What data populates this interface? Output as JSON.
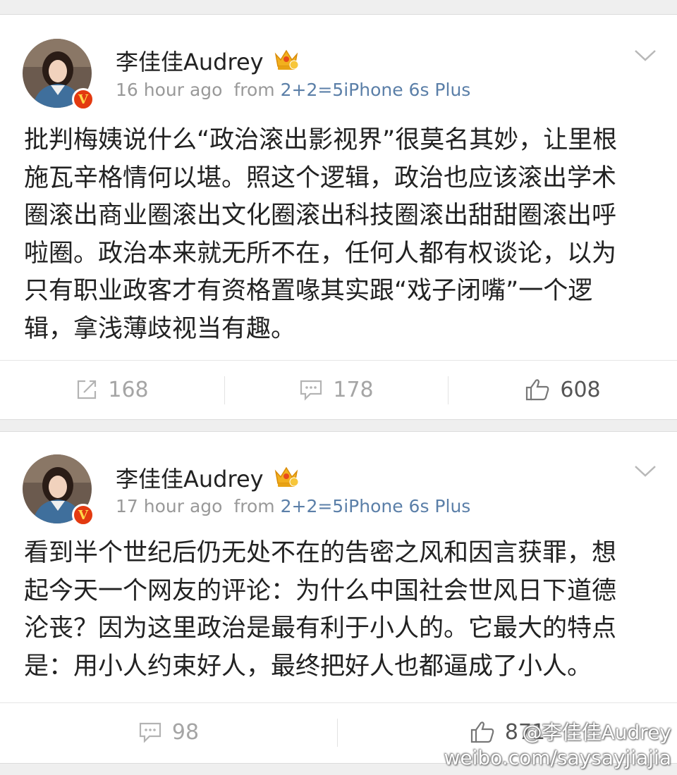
{
  "posts": [
    {
      "author": "李佳佳Audrey",
      "time": "16 hour ago",
      "from_label": "from",
      "source": "2+2=5iPhone 6s Plus",
      "verified_badge": "V",
      "body_lines": [
        "批判梅姨说什么“政治滚出影视界”很莫名其妙，让里根",
        "施瓦辛格情何以堪。照这个逻辑，政治也应该滚出学术",
        "圈滚出商业圈滚出文化圈滚出科技圈滚出甜甜圈滚出呼",
        "啦圈。政治本来就无所不在，任何人都有权谈论，以为",
        "只有职业政客才有资格置喙其实跟“戏子闭嘴”一个逻",
        "辑，拿浅薄歧视当有趣。"
      ],
      "reposts": "168",
      "comments": "178",
      "likes": "608"
    },
    {
      "author": "李佳佳Audrey",
      "time": "17 hour ago",
      "from_label": "from",
      "source": "2+2=5iPhone 6s Plus",
      "verified_badge": "V",
      "body_lines": [
        "看到半个世纪后仍无处不在的告密之风和因言获罪，想",
        "起今天一个网友的评论：为什么中国社会世风日下道德",
        "沦丧？因为这里政治是最有利于小人的。它最大的特点",
        "是：用小人约束好人，最终把好人也都逼成了小人。"
      ],
      "comments": "98",
      "likes": "871"
    }
  ],
  "watermark": {
    "line1": "@李佳佳Audrey",
    "line2": "weibo.com/saysayjiajia"
  },
  "icons": {
    "repost": "repost-icon",
    "comment": "comment-icon",
    "like": "thumbs-up-icon",
    "menu": "chevron-down-icon",
    "member": "crown-icon"
  },
  "colors": {
    "background": "#efefef",
    "card": "#ffffff",
    "text": "#222222",
    "meta": "#999999",
    "source_link": "#5b7fa8",
    "verified": "#e33a10",
    "crown": "#f2b01e"
  }
}
